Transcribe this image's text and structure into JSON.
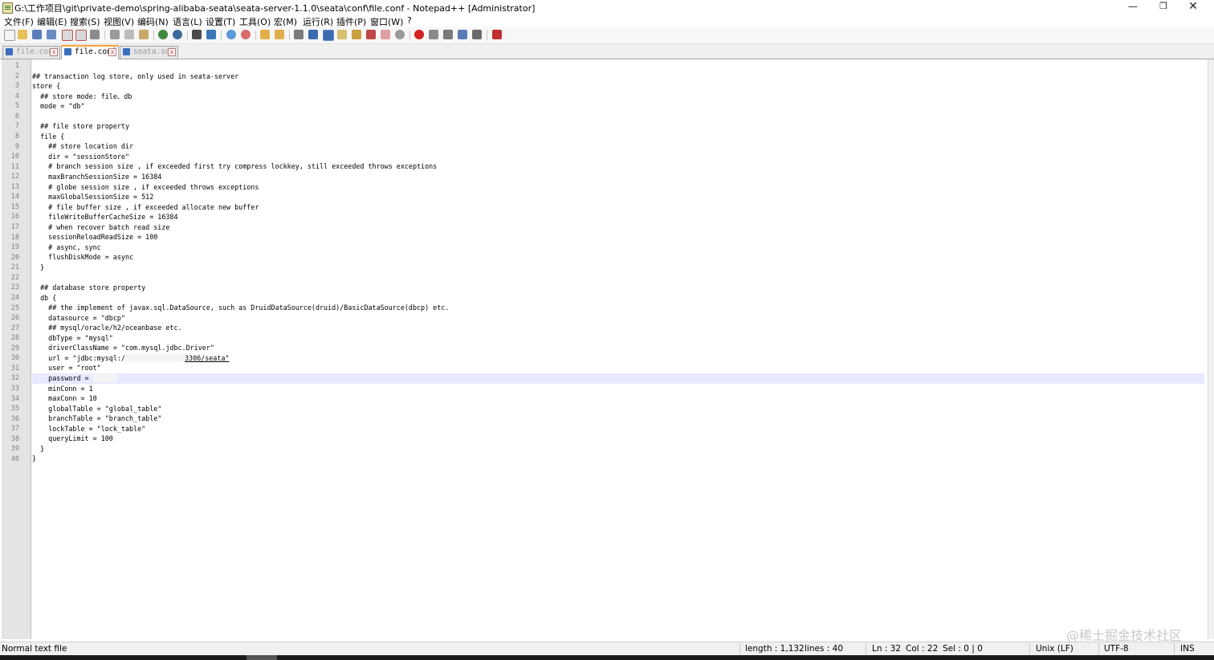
{
  "window": {
    "title": "G:\\工作项目\\git\\private-demo\\spring-alibaba-seata\\seata-server-1.1.0\\seata\\conf\\file.conf - Notepad++ [Administrator]",
    "minimize": "—",
    "maximize": "❐",
    "close": "✕",
    "doc_close": "X"
  },
  "menu": [
    "文件(F)",
    "编辑(E)",
    "搜索(S)",
    "视图(V)",
    "编码(N)",
    "语言(L)",
    "设置(T)",
    "工具(O)",
    "宏(M)",
    "运行(R)",
    "插件(P)",
    "窗口(W)",
    "?"
  ],
  "tabs": [
    {
      "label": "file.conf",
      "active": false
    },
    {
      "label": "file.conf",
      "active": true
    },
    {
      "label": "seata.sql",
      "active": false
    }
  ],
  "tab_close": "x",
  "line_numbers": [
    "1",
    "2",
    "3",
    "4",
    "5",
    "6",
    "7",
    "8",
    "9",
    "10",
    "11",
    "12",
    "13",
    "14",
    "15",
    "16",
    "17",
    "18",
    "19",
    "20",
    "21",
    "22",
    "23",
    "24",
    "25",
    "26",
    "27",
    "28",
    "29",
    "30",
    "31",
    "32",
    "33",
    "34",
    "35",
    "36",
    "37",
    "38",
    "39",
    "40"
  ],
  "code": [
    "",
    "## transaction log store, only used in seata-server",
    "store {",
    "  ## store mode: file、db",
    "  mode = \"db\"",
    "",
    "  ## file store property",
    "  file {",
    "    ## store location dir",
    "    dir = \"sessionStore\"",
    "    # branch session size , if exceeded first try compress lockkey, still exceeded throws exceptions",
    "    maxBranchSessionSize = 16384",
    "    # globe session size , if exceeded throws exceptions",
    "    maxGlobalSessionSize = 512",
    "    # file buffer size , if exceeded allocate new buffer",
    "    fileWriteBufferCacheSize = 16384",
    "    # when recover batch read size",
    "    sessionReloadReadSize = 100",
    "    # async, sync",
    "    flushDiskMode = async",
    "  }",
    "",
    "  ## database store property",
    "  db {",
    "    ## the implement of javax.sql.DataSource, such as DruidDataSource(druid)/BasicDataSource(dbcp) etc.",
    "    datasource = \"dbcp\"",
    "    ## mysql/oracle/h2/oceanbase etc.",
    "    dbType = \"mysql\"",
    "    driverClassName = \"com.mysql.jdbc.Driver\"",
    "    url = \"jdbc:mysql:/",
    "    user = \"root\"",
    "    password = ",
    "    minConn = 1",
    "    maxConn = 10",
    "    globalTable = \"global_table\"",
    "    branchTable = \"branch_table\"",
    "    lockTable = \"lock_table\"",
    "    queryLimit = 100",
    "  }",
    "}"
  ],
  "url_tail": "3306/seata\"",
  "current_line": 32,
  "status": {
    "file_type": "Normal text file",
    "length": "length : 1,132",
    "lines": "lines : 40",
    "ln": "Ln : 32",
    "col": "Col : 22",
    "sel": "Sel : 0 | 0",
    "eol": "Unix (LF)",
    "encoding": "UTF-8",
    "mode": "INS"
  },
  "watermark": "@稀土掘金技术社区",
  "colors": {
    "current_line_bg": "#e8e8ff",
    "gutter_bg": "#e4e4e4",
    "active_tab_accent": "#f9a238"
  }
}
